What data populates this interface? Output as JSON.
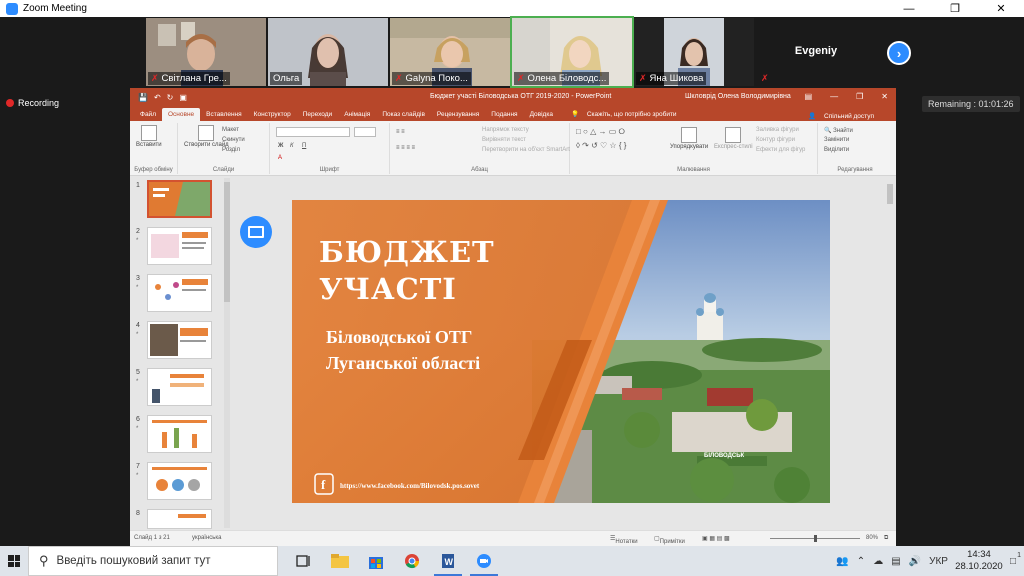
{
  "zoom": {
    "window_title": "Zoom Meeting",
    "participants": [
      {
        "name": "Світлана Гре..."
      },
      {
        "name": "Ольга"
      },
      {
        "name": "Galyna Поко..."
      },
      {
        "name": "Олена Біловодс..."
      },
      {
        "name": "Яна Шикова"
      },
      {
        "name": "Evgeniy"
      }
    ],
    "recording_label": "Recording",
    "remaining_label": "Remaining : 01:01:26"
  },
  "ppt": {
    "doc_title": "Бюджет участі Біловодська ОТГ 2019-2020  -  PowerPoint",
    "user_name": "Шкловрід Олена Володимирівна",
    "tabs": [
      "Файл",
      "Основне",
      "Вставлення",
      "Конструктор",
      "Переходи",
      "Анімація",
      "Показ слайдів",
      "Рецензування",
      "Подання",
      "Довідка"
    ],
    "tell_me": "Скажіть, що потрібно зробити",
    "share": "Спільний доступ",
    "ribbon": {
      "paste": "Вставити",
      "clipboard_group": "Буфер обміну",
      "new_slide": "Створити слайд",
      "layout": "Макет",
      "reset": "Скинути",
      "section": "Розділ",
      "slides_group": "Слайди",
      "font_group": "Шрифт",
      "paragraph_group": "Абзац",
      "text_direction": "Напрямок тексту",
      "align_text": "Вирівняти текст",
      "smartart": "Перетворити на об'єкт SmartArt",
      "arrange": "Упорядкувати",
      "quick_styles": "Експрес-стилі",
      "shape_fill": "Заливка фігури",
      "shape_outline": "Контур фігури",
      "shape_effects": "Ефекти для фігур",
      "drawing_group": "Малювання",
      "find": "Знайти",
      "replace": "Замінити",
      "select": "Виділити",
      "editing_group": "Редагування"
    },
    "slide": {
      "title_line1": "БЮДЖЕТ",
      "title_line2": "УЧАСТІ",
      "subtitle_line1": "Біловодської ОТГ",
      "subtitle_line2": "Луганської області",
      "link": "https://www.facebook.com/Bilovodsk.pos.sovet",
      "sign_text": "БІЛОВОДСЬК"
    },
    "thumbnail_numbers": [
      "1",
      "2",
      "3",
      "4",
      "5",
      "6",
      "7",
      "8"
    ],
    "statusbar": {
      "slide_info": "Слайд 1 з 21",
      "language": "українська",
      "notes": "Нотатки",
      "comments": "Примітки",
      "zoom": "80%"
    }
  },
  "taskbar": {
    "search_placeholder": "Введіть пошуковий запит тут",
    "language": "УКР",
    "time": "14:34",
    "date": "28.10.2020",
    "notification_count": "1"
  }
}
